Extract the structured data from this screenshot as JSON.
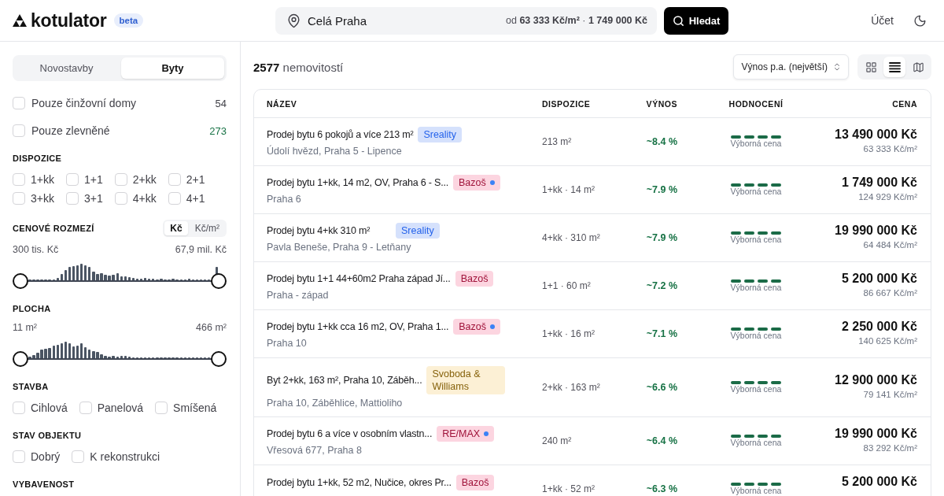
{
  "header": {
    "logo": "kotulator",
    "badge": "beta",
    "search": {
      "location": "Celá Praha",
      "summary": "od **63 333 Kč/m²** · **1 749 000 Kč**"
    },
    "search_button": "Hledat",
    "account": "Účet"
  },
  "sidebar": {
    "tabs": [
      {
        "label": "Novostavby",
        "selected": false
      },
      {
        "label": "Byty",
        "selected": true
      }
    ],
    "toggles": [
      {
        "label": "Pouze činžovní domy",
        "count": "54",
        "color": "#3f3f46",
        "checked": false
      },
      {
        "label": "Pouze zlevněné",
        "count": "273",
        "color": "#177245",
        "checked": false
      }
    ],
    "sections": [
      {
        "kind": "checkboxes",
        "title": "DISPOZICE",
        "options": [
          {
            "label": "1+kk",
            "checked": false
          },
          {
            "label": "1+1",
            "checked": false
          },
          {
            "label": "2+kk",
            "checked": false
          },
          {
            "label": "2+1",
            "checked": false
          },
          {
            "label": "3+kk",
            "checked": false
          },
          {
            "label": "3+1",
            "checked": false
          },
          {
            "label": "4+kk",
            "checked": false
          },
          {
            "label": "4+1",
            "checked": false
          }
        ]
      },
      {
        "kind": "range",
        "title": "CENOVÉ ROZMEZÍ",
        "units": [
          {
            "label": "Kč",
            "selected": true
          },
          {
            "label": "Kč/m²",
            "selected": false
          }
        ],
        "min": "300 tis. Kč",
        "max": "67,9 mil. Kč",
        "thumbs": [
          {
            "level": 0
          },
          {
            "level": 1
          }
        ]
      },
      {
        "kind": "range",
        "title": "PLOCHA",
        "min": "11 m²",
        "max": "466 m²",
        "thumbs": [
          {
            "level": 0
          },
          {
            "level": 1
          }
        ]
      },
      {
        "kind": "checkboxes",
        "title": "STAVBA",
        "options": [
          {
            "label": "Cihlová",
            "checked": false
          },
          {
            "label": "Panelová",
            "checked": false
          },
          {
            "label": "Smíšená",
            "checked": false
          }
        ]
      },
      {
        "kind": "checkboxes",
        "title": "STAV OBJEKTU",
        "options": [
          {
            "label": "Dobrý",
            "checked": false
          },
          {
            "label": "K rekonstrukci",
            "checked": false
          }
        ]
      },
      {
        "kind": "checkboxes",
        "title": "VYBAVENOST"
      }
    ]
  },
  "results": {
    "count": "**2577** nemovitostí",
    "sort": "Výnos p.a. (největší)",
    "views": [
      {
        "kind": "grid",
        "selected": false
      },
      {
        "kind": "list",
        "selected": true
      },
      {
        "kind": "map",
        "selected": false
      }
    ]
  },
  "table": {
    "columns": [
      "NÁZEV",
      "DISPOZICE",
      "VÝNOS",
      "HODNOCENÍ",
      "CENA"
    ],
    "rows": [
      {
        "title": "Prodej bytu 6 pokojů a více 213 m²",
        "source": {
          "label": "Sreality",
          "color": "#2563eb",
          "dot": false
        },
        "address": "Údolí hvězd, Praha 5 - Lipence",
        "disposition": "213 m²",
        "yield": "~8.4 %",
        "stars": 4,
        "rating": "Výborná cena",
        "price": "13 490 000 Kč",
        "price_per_m2": "63 333 Kč/m²"
      },
      {
        "title": "Prodej bytu 1+kk, 14 m2, OV, Praha 6 - S...",
        "source": {
          "label": "Bazoš",
          "color": "#9f1239",
          "dot": true
        },
        "address": "Praha 6",
        "disposition": "1+kk · 14 m²",
        "yield": "~7.9 %",
        "stars": 4,
        "rating": "Výborná cena",
        "price": "1 749 000 Kč",
        "price_per_m2": "124 929 Kč/m²"
      },
      {
        "title": "Prodej bytu 4+kk 310 m²",
        "source": {
          "label": "Sreality",
          "color": "#2563eb",
          "dot": false
        },
        "address": "Pavla Beneše, Praha 9 - Letňany",
        "disposition": "4+kk · 310 m²",
        "yield": "~7.9 %",
        "stars": 4,
        "rating": "Výborná cena",
        "price": "19 990 000 Kč",
        "price_per_m2": "64 484 Kč/m²"
      },
      {
        "title": "Prodej bytu 1+1 44+60m2 Praha západ Jí...",
        "source": {
          "label": "Bazoš",
          "color": "#9f1239",
          "dot": false
        },
        "address": "Praha - západ",
        "disposition": "1+1 · 60 m²",
        "yield": "~7.2 %",
        "stars": 4,
        "rating": "Výborná cena",
        "price": "5 200 000 Kč",
        "price_per_m2": "86 667 Kč/m²"
      },
      {
        "title": "Prodej bytu 1+kk cca 16 m2, OV, Praha 1...",
        "source": {
          "label": "Bazoš",
          "color": "#9f1239",
          "dot": true
        },
        "address": "Praha 10",
        "disposition": "1+kk · 16 m²",
        "yield": "~7.1 %",
        "stars": 4,
        "rating": "Výborná cena",
        "price": "2 250 000 Kč",
        "price_per_m2": "140 625 Kč/m²"
      },
      {
        "title": "Byt 2+kk, 163 m², Praha 10, Záběh...",
        "source": {
          "label": "Svoboda & Williams",
          "color": "#86620c",
          "dot": false
        },
        "address": "Praha 10, Záběhlice, Mattioliho",
        "disposition": "2+kk · 163 m²",
        "yield": "~6.6 %",
        "stars": 4,
        "rating": "Výborná cena",
        "price": "12 900 000 Kč",
        "price_per_m2": "79 141 Kč/m²"
      },
      {
        "title": "Prodej bytu 6 a více v osobním vlastn...",
        "source": {
          "label": "RE/MAX",
          "color": "#9f1239",
          "dot": true
        },
        "address": "Vřesová 677, Praha 8",
        "disposition": "240 m²",
        "yield": "~6.4 %",
        "stars": 4,
        "rating": "Výborná cena",
        "price": "19 990 000 Kč",
        "price_per_m2": "83 292 Kč/m²"
      },
      {
        "title": "Prodej bytu 1+kk, 52 m2, Nučice, okres Pr...",
        "source": {
          "label": "Bazoš",
          "color": "#9f1239",
          "dot": false
        },
        "disposition": "1+kk · 52 m²",
        "yield": "~6.3 %",
        "stars": 4,
        "rating": "Výborná cena",
        "price": "5 200 000 Kč"
      }
    ]
  }
}
